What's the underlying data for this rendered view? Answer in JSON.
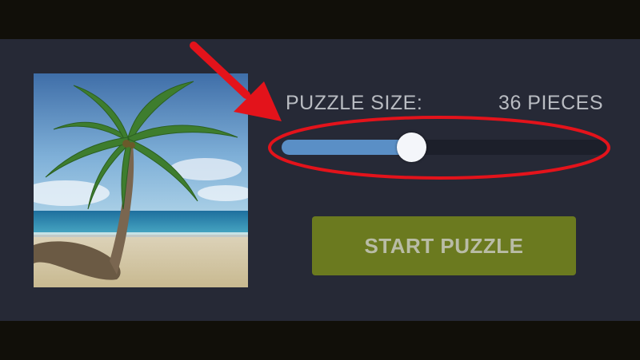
{
  "puzzle": {
    "size_label": "PUZZLE SIZE:",
    "pieces_label": "36 PIECES",
    "start_label": "START PUZZLE"
  },
  "slider": {
    "value_fraction": 0.4
  },
  "thumbnail": {
    "subject": "palm-tree-beach"
  },
  "colors": {
    "panel": "#262936",
    "letterbox": "#110f09",
    "slider_track": "#1c1f2a",
    "slider_fill": "#5a8fc6",
    "slider_thumb": "#f4f6fa",
    "start_button": "#6b7a1f",
    "annotation": "#e3131b"
  },
  "annotation": {
    "arrow": "arrow-icon",
    "highlight": "ellipse-highlight"
  }
}
